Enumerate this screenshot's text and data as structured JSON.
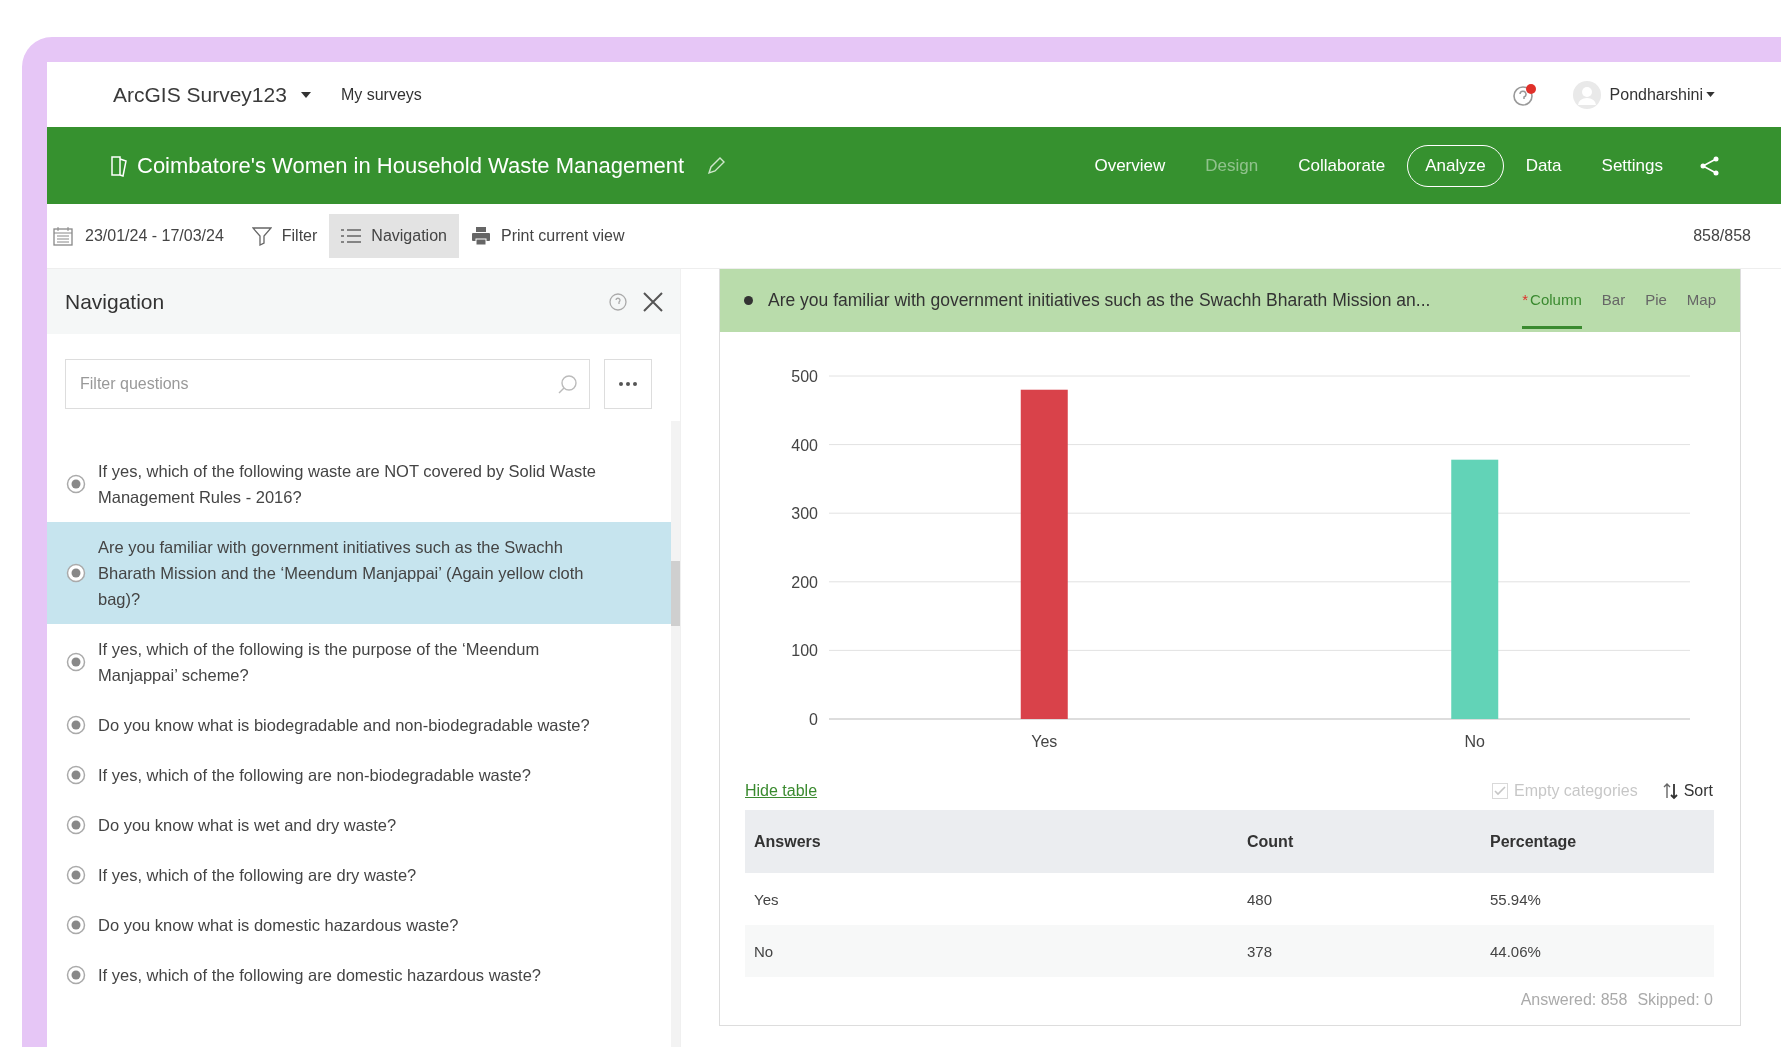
{
  "app": {
    "product": "ArcGIS Survey123",
    "my_surveys": "My surveys",
    "user": "Pondharshini"
  },
  "survey": {
    "title": "Coimbatore's Women in Household Waste Management",
    "tabs": [
      {
        "label": "Overview",
        "selected": false,
        "disabled": false
      },
      {
        "label": "Design",
        "selected": false,
        "disabled": true
      },
      {
        "label": "Collaborate",
        "selected": false,
        "disabled": false
      },
      {
        "label": "Analyze",
        "selected": true,
        "disabled": false
      },
      {
        "label": "Data",
        "selected": false,
        "disabled": false
      },
      {
        "label": "Settings",
        "selected": false,
        "disabled": false
      }
    ]
  },
  "toolbar": {
    "date_range": "23/01/24 - 17/03/24",
    "buttons": [
      {
        "kind": "filter",
        "label": "Filter",
        "selected": false
      },
      {
        "kind": "navigation",
        "label": "Navigation",
        "selected": true
      },
      {
        "kind": "print",
        "label": "Print current view",
        "selected": false
      }
    ],
    "count": "858/858"
  },
  "navigation": {
    "title": "Navigation",
    "search": {
      "placeholder": "Filter questions"
    },
    "questions": [
      {
        "text": "If yes, which of the following waste are NOT covered by Solid Waste Management Rules - 2016?",
        "selected": false
      },
      {
        "text": "Are you familiar with government initiatives such as the Swachh Bharath Mission and the ‘Meendum Manjappai’ (Again yellow cloth bag)?",
        "selected": true
      },
      {
        "text": "If yes, which of the following is the purpose of the ‘Meendum Manjappai’ scheme?",
        "selected": false
      },
      {
        "text": "Do you know what is biodegradable and non-biodegradable waste?",
        "selected": false
      },
      {
        "text": "If yes, which of the following are non-biodegradable waste?",
        "selected": false
      },
      {
        "text": "Do you know what is wet and dry waste?",
        "selected": false
      },
      {
        "text": "If yes, which of the following are dry waste?",
        "selected": false
      },
      {
        "text": "Do you know what is domestic hazardous waste?",
        "selected": false
      },
      {
        "text": "If yes, which of the following are domestic hazardous waste?",
        "selected": false
      }
    ]
  },
  "question_panel": {
    "title": "Are you familiar with government initiatives such as the Swachh Bharath Mission an...",
    "chart_types": [
      {
        "label": "Column",
        "selected": true,
        "marker": "*"
      },
      {
        "label": "Bar",
        "selected": false
      },
      {
        "label": "Pie",
        "selected": false
      },
      {
        "label": "Map",
        "selected": false
      }
    ],
    "chart_data": {
      "type": "bar",
      "categories": [
        "Yes",
        "No"
      ],
      "values": [
        480,
        378
      ],
      "colors": [
        "#d9424a",
        "#62d3b7"
      ],
      "ylim": [
        0,
        500
      ],
      "yticks": [
        0,
        100,
        200,
        300,
        400,
        500
      ],
      "grid": true
    },
    "hide_table": "Hide table",
    "empty_categories": {
      "label": "Empty categories",
      "checked": true,
      "disabled": true
    },
    "sort": "Sort",
    "table": {
      "columns": [
        "Answers",
        "Count",
        "Percentage"
      ],
      "rows": [
        [
          "Yes",
          "480",
          "55.94%"
        ],
        [
          "No",
          "378",
          "44.06%"
        ]
      ]
    },
    "answered": "Answered: 858",
    "skipped": "Skipped: 0"
  }
}
